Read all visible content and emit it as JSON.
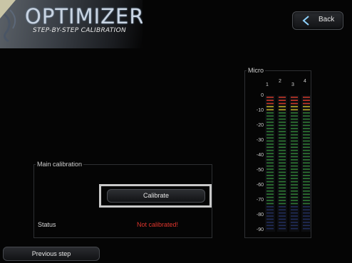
{
  "header": {
    "title": "OPTIMIZER",
    "subtitle": "STEP-BY-STEP CALIBRATION"
  },
  "back_button": {
    "label": "Back",
    "icon": "back-arrow-icon"
  },
  "main_calibration": {
    "title": "Main calibration",
    "calibrate_label": "Calibrate",
    "status_label": "Status",
    "status_value": "Not calibrated!",
    "status_color": "#e0352d"
  },
  "previous_button": {
    "label": "Previous step"
  },
  "micro": {
    "title": "Micro",
    "channels": [
      "1",
      "2",
      "3",
      "4"
    ],
    "scale": [
      "0",
      "-10",
      "-20",
      "-30",
      "-40",
      "-50",
      "-60",
      "-70",
      "-80",
      "-90"
    ],
    "colors": {
      "red": "#d23a2a",
      "yellow": "#c8b52a",
      "green": "#3fa844",
      "blue": "#2b3c7a"
    }
  }
}
